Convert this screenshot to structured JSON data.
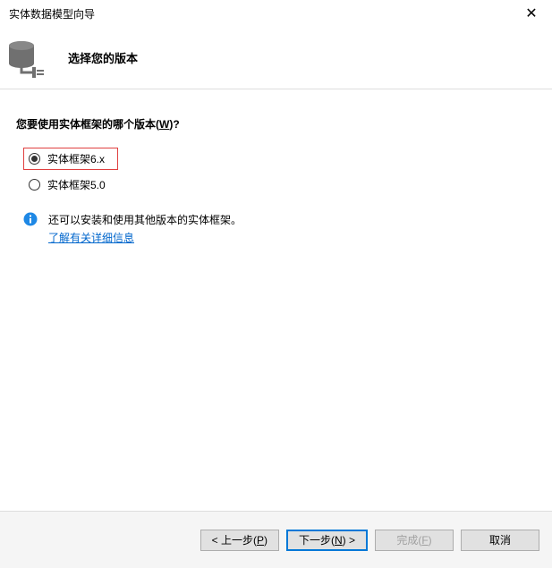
{
  "titlebar": {
    "title": "实体数据模型向导"
  },
  "header": {
    "title": "选择您的版本"
  },
  "prompt": {
    "text_before": "您要使用实体框架的哪个版本(",
    "access_key": "W",
    "text_after": ")?"
  },
  "options": [
    {
      "label": "实体框架6.x",
      "selected": true,
      "highlighted": true
    },
    {
      "label": "实体框架5.0",
      "selected": false,
      "highlighted": false
    }
  ],
  "info": {
    "text": "还可以安装和使用其他版本的实体框架。",
    "link": "了解有关详细信息"
  },
  "footer": {
    "back": {
      "prefix": "< 上一步(",
      "key": "P",
      "suffix": ")"
    },
    "next": {
      "prefix": "下一步(",
      "key": "N",
      "suffix": ") >"
    },
    "finish": {
      "prefix": "完成(",
      "key": "F",
      "suffix": ")"
    },
    "cancel": {
      "label": "取消"
    }
  }
}
